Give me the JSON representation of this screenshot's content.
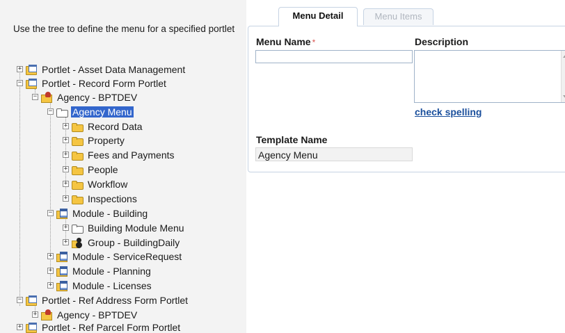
{
  "intro_text": "Use the tree to define the menu for a specified portlet",
  "tree": {
    "nodes": [
      {
        "id": "portlet-asset",
        "label": "Portlet - Asset Data Management",
        "icon": "portlet-icon",
        "expander": "+"
      },
      {
        "id": "portlet-record",
        "label": "Portlet - Record Form Portlet",
        "icon": "portlet-icon",
        "expander": "−"
      },
      {
        "id": "agency-bptdev-1",
        "label": "Agency - BPTDEV",
        "icon": "agency-icon",
        "expander": "−"
      },
      {
        "id": "agency-menu",
        "label": "Agency Menu",
        "icon": "open-folder-icon",
        "expander": "−",
        "selected": true
      },
      {
        "id": "record-data",
        "label": "Record Data",
        "icon": "folder-icon",
        "expander": "+"
      },
      {
        "id": "property",
        "label": "Property",
        "icon": "folder-icon",
        "expander": "+"
      },
      {
        "id": "fees",
        "label": "Fees and Payments",
        "icon": "folder-icon",
        "expander": "+"
      },
      {
        "id": "people",
        "label": "People",
        "icon": "folder-icon",
        "expander": "+"
      },
      {
        "id": "workflow",
        "label": "Workflow",
        "icon": "folder-icon",
        "expander": "+"
      },
      {
        "id": "inspections",
        "label": "Inspections",
        "icon": "folder-icon",
        "expander": "+"
      },
      {
        "id": "module-building",
        "label": "Module - Building",
        "icon": "module-icon",
        "expander": "−"
      },
      {
        "id": "building-menu",
        "label": "Building Module Menu",
        "icon": "open-folder-icon",
        "expander": "+"
      },
      {
        "id": "group-building",
        "label": "Group - BuildingDaily",
        "icon": "group-icon",
        "expander": "+"
      },
      {
        "id": "module-service",
        "label": "Module - ServiceRequest",
        "icon": "module-icon",
        "expander": "+"
      },
      {
        "id": "module-planning",
        "label": "Module - Planning",
        "icon": "module-icon",
        "expander": "+"
      },
      {
        "id": "module-licenses",
        "label": "Module - Licenses",
        "icon": "module-icon",
        "expander": "+"
      },
      {
        "id": "portlet-refaddr",
        "label": "Portlet - Ref Address Form Portlet",
        "icon": "portlet-icon",
        "expander": "−"
      },
      {
        "id": "agency-bptdev-2",
        "label": "Agency - BPTDEV",
        "icon": "agency-icon",
        "expander": "+"
      },
      {
        "id": "portlet-refparcel",
        "label": "Portlet - Ref Parcel Form Portlet",
        "icon": "portlet-icon",
        "expander": "+"
      }
    ]
  },
  "tabs": {
    "menu_detail": "Menu Detail",
    "menu_items": "Menu Items"
  },
  "form": {
    "menu_name_label": "Menu Name",
    "required_marker": "*",
    "menu_name_value": "",
    "description_label": "Description",
    "description_value": "",
    "check_spelling": "check spelling",
    "template_name_label": "Template Name",
    "template_name_value": "Agency Menu"
  },
  "colors": {
    "selection": "#3366cc",
    "link": "#1a4f9c",
    "required": "#d9534f",
    "left_pane_bg": "#f3f3f3"
  }
}
